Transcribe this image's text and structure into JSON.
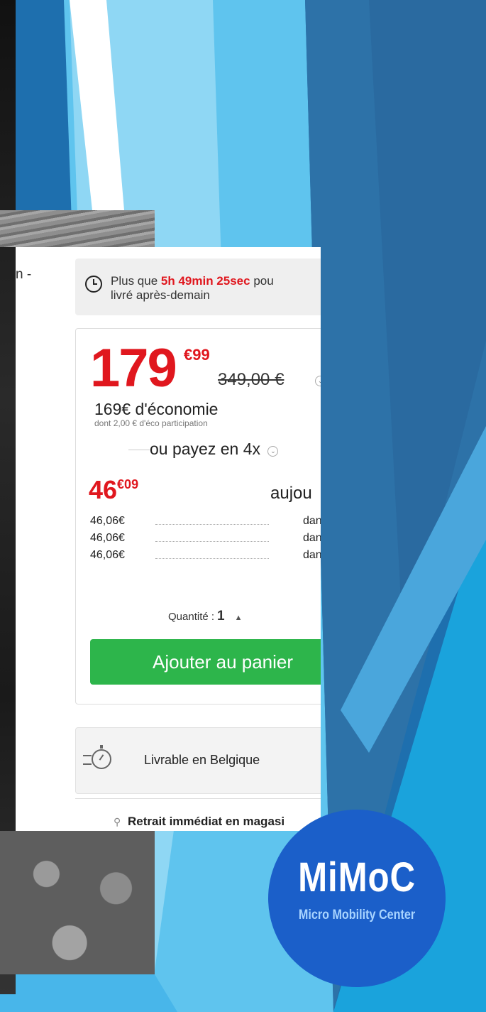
{
  "colors": {
    "price_red": "#e0171e",
    "button_green": "#2db54b",
    "logo_blue": "#1b5fc9",
    "slide_blue": "#1e6fae"
  },
  "left_text": "n -",
  "timer": {
    "prefix": "Plus que ",
    "countdown": "5h 49min 25sec",
    "suffix": " pou",
    "line2": "livré après-demain"
  },
  "price": {
    "integer": "179",
    "decimals": "€99",
    "old": "349,00 €",
    "savings": "169€ d'économie",
    "eco": "dont 2,00 € d'éco participation"
  },
  "installments": {
    "header": "ou payez en 4x",
    "first_integer": "46",
    "first_decimals": "€09",
    "first_when": "aujou",
    "rows": [
      {
        "amount": "46,06€",
        "when": "dans"
      },
      {
        "amount": "46,06€",
        "when": "dans"
      },
      {
        "amount": "46,06€",
        "when": "dans"
      }
    ]
  },
  "quantity": {
    "label": "Quantité :",
    "value": "1"
  },
  "add_to_cart": "Ajouter au panier",
  "delivery": "Livrable en Belgique",
  "store_pickup": "Retrait immédiat en magasi",
  "logo": {
    "main": "MiMoC",
    "sub": "Micro Mobility Center"
  }
}
